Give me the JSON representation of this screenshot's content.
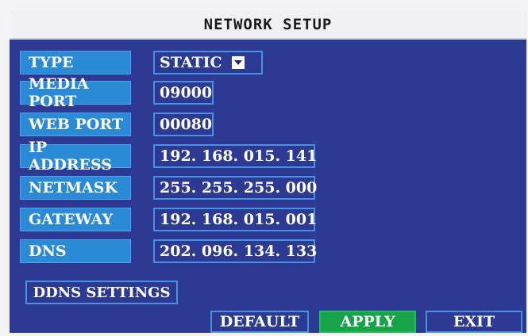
{
  "window": {
    "title": "NETWORK SETUP"
  },
  "fields": {
    "type": {
      "label": "TYPE",
      "value": "STATIC"
    },
    "media_port": {
      "label": "MEDIA PORT",
      "value": "09000"
    },
    "web_port": {
      "label": "WEB PORT",
      "value": "00080"
    },
    "ip_address": {
      "label": "IP ADDRESS",
      "value": "192. 168. 015. 141"
    },
    "netmask": {
      "label": "NETMASK",
      "value": "255. 255. 255. 000"
    },
    "gateway": {
      "label": "GATEWAY",
      "value": "192. 168. 015. 001"
    },
    "dns": {
      "label": "DNS",
      "value": "202. 096. 134. 133"
    }
  },
  "buttons": {
    "ddns": "DDNS SETTINGS",
    "default": "DEFAULT",
    "apply": "APPLY",
    "exit": "EXIT"
  },
  "colors": {
    "background": "#2c3a94",
    "label_bg": "#2a8ad6",
    "field_border": "#4b8fe0",
    "apply_bg": "#16a34a"
  }
}
